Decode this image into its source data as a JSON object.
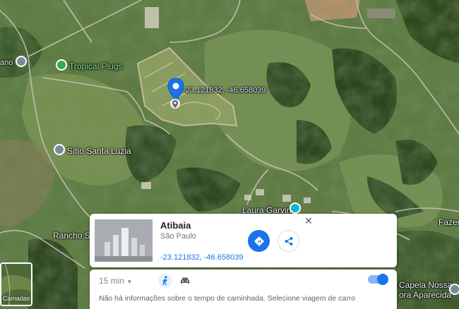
{
  "map": {
    "labels": {
      "tropical_plugs": "Tropical Plugs",
      "sitio_santa_luzia": "Sítio Santa Luzia",
      "laura_garvin": "Laura Garvin",
      "rancho": "Rancho S",
      "fazenda": "Fazen",
      "capela_line1": "Capela Nossa",
      "capela_line2": "ora Aparecida",
      "left_edge": "ano"
    },
    "pin_coords": "-23.121832, -46.658039"
  },
  "card": {
    "title": "Atibaia",
    "subtitle": "São Paulo",
    "coords": "-23.121832, -46.658039",
    "close_glyph": "✕"
  },
  "panel": {
    "time": "15 min",
    "info": "Não há informações sobre o tempo de caminhada. Selecione viagem de carro"
  },
  "layers": {
    "label": "Camadas"
  },
  "colors": {
    "accent": "#1a73e8",
    "poi_green": "#34a853",
    "poi_teal": "#12b5cb",
    "poi_gray": "#7b8c99"
  }
}
